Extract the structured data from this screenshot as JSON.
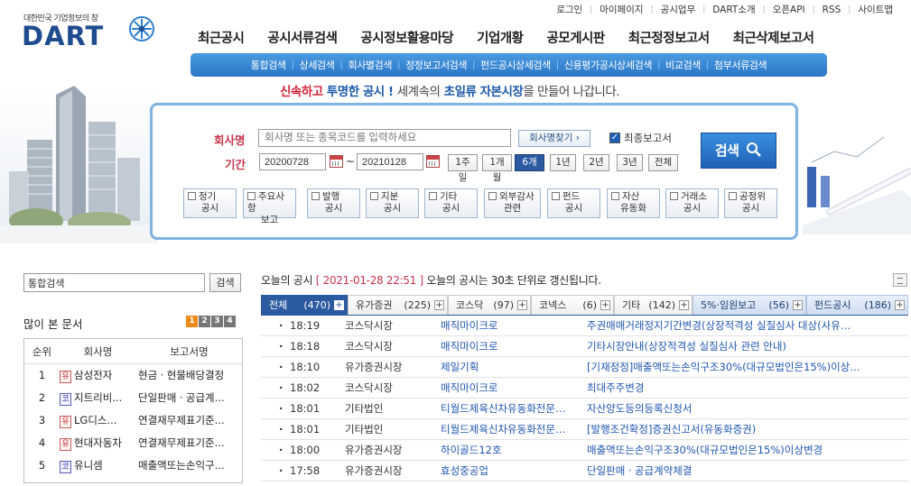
{
  "util_links": [
    "로그인",
    "마이페이지",
    "공시업무",
    "DART소개",
    "오픈API",
    "RSS",
    "사이트맵"
  ],
  "logo": {
    "tagline": "대한민국 기업정보의 창",
    "word": "DART"
  },
  "main_nav": [
    "최근공시",
    "공시서류검색",
    "공시정보활용마당",
    "기업개황",
    "공모게시판",
    "최근정정보고서",
    "최근삭제보고서"
  ],
  "sub_nav": [
    "통합검색",
    "상세검색",
    "회사별검색",
    "정정보고서검색",
    "펀드공시상세검색",
    "신용평가공시상세검색",
    "비교검색",
    "첨부서류검색"
  ],
  "slogan": {
    "p1": "신속하고",
    "p2": "투명한 공시 !",
    "p3": "세계속의",
    "p4": "초일류",
    "p5": "자본시장",
    "p6": "을 만들어 나갑니다."
  },
  "search": {
    "company_label": "회사명",
    "company_placeholder": "회사명 또는 종목코드를 입력하세요",
    "find_button": "회사명찾기 ›",
    "latest_only_label": "최종보고서",
    "latest_only_checked": true,
    "period_label": "기간",
    "date_from": "20200728",
    "date_to": "20210128",
    "periods": [
      "1주일",
      "1개월",
      "6개월",
      "1년",
      "2년",
      "3년",
      "전체"
    ],
    "active_period": "6개월",
    "search_button": "검색",
    "types": [
      {
        "l1": "정기",
        "l2": "공시"
      },
      {
        "l1": "주요사항",
        "l2": "보고"
      },
      {
        "l1": "발행",
        "l2": "공시"
      },
      {
        "l1": "지분",
        "l2": "공시"
      },
      {
        "l1": "기타",
        "l2": "공시"
      },
      {
        "l1": "외부감사",
        "l2": "관련"
      },
      {
        "l1": "펀드",
        "l2": "공시"
      },
      {
        "l1": "자산",
        "l2": "유동화"
      },
      {
        "l1": "거래소",
        "l2": "공시"
      },
      {
        "l1": "공정위",
        "l2": "공시"
      }
    ]
  },
  "side": {
    "search_value": "통합검색",
    "search_button": "검색",
    "most_viewed_title": "많이 본 문서",
    "pages": [
      "1",
      "2",
      "3",
      "4"
    ],
    "headers": [
      "순위",
      "회사명",
      "보고서명"
    ],
    "rows": [
      {
        "rank": "1",
        "mkt": "유",
        "company": "삼성전자",
        "report": "현금ㆍ현물배당결정"
      },
      {
        "rank": "2",
        "mkt": "코",
        "company": "지트리비...",
        "report": "단일판매ㆍ공급계..."
      },
      {
        "rank": "3",
        "mkt": "유",
        "company": "LG디스...",
        "report": "연결재무제표기준..."
      },
      {
        "rank": "4",
        "mkt": "유",
        "company": "현대자동차",
        "report": "연결재무제표기준..."
      },
      {
        "rank": "5",
        "mkt": "코",
        "company": "유니셈",
        "report": "매출액또는손익구..."
      }
    ]
  },
  "today": {
    "title": "오늘의 공시",
    "time": "[ 2021-01-28 22:51 ]",
    "note": "오늘의 공시는 30초 단위로 갱신됩니다.",
    "tabs": [
      {
        "label": "전체",
        "count": "(470)"
      },
      {
        "label": "유가증권",
        "count": "(225)"
      },
      {
        "label": "코스닥",
        "count": "(97)"
      },
      {
        "label": "코넥스",
        "count": "(6)"
      },
      {
        "label": "기타",
        "count": "(142)"
      },
      {
        "label": "5%·임원보고",
        "count": "(56)"
      },
      {
        "label": "펀드공시",
        "count": "(186)"
      }
    ],
    "rows": [
      {
        "time": "18:19",
        "market": "코스닥시장",
        "company": "매직마이크로",
        "report": "주권매매거래정지기간변경(상장적격성 실질심사 대상(사유…"
      },
      {
        "time": "18:18",
        "market": "코스닥시장",
        "company": "매직마이크로",
        "report": "기타시장안내(상장적격성 실질심사 관련 안내)"
      },
      {
        "time": "18:10",
        "market": "유가증권시장",
        "company": "제일기획",
        "report": "[기재정정]매출액또는손익구조30%(대규모법인은15%)이상…"
      },
      {
        "time": "18:02",
        "market": "코스닥시장",
        "company": "매직마이크로",
        "report": "최대주주변경"
      },
      {
        "time": "18:01",
        "market": "기타법인",
        "company": "티월드제육신차유동화전문…",
        "report": "자산양도등의등록신청서"
      },
      {
        "time": "18:01",
        "market": "기타법인",
        "company": "티월드제육신차유동화전문…",
        "report": "[발행조건확정]증권신고서(유동화증권)"
      },
      {
        "time": "18:00",
        "market": "유가증권시장",
        "company": "하이골드12호",
        "report": "매출액또는손익구조30%(대규모법인은15%)이상변경"
      },
      {
        "time": "17:58",
        "market": "유가증권시장",
        "company": "효성중공업",
        "report": "단일판매ㆍ공급계약체결"
      }
    ]
  }
}
